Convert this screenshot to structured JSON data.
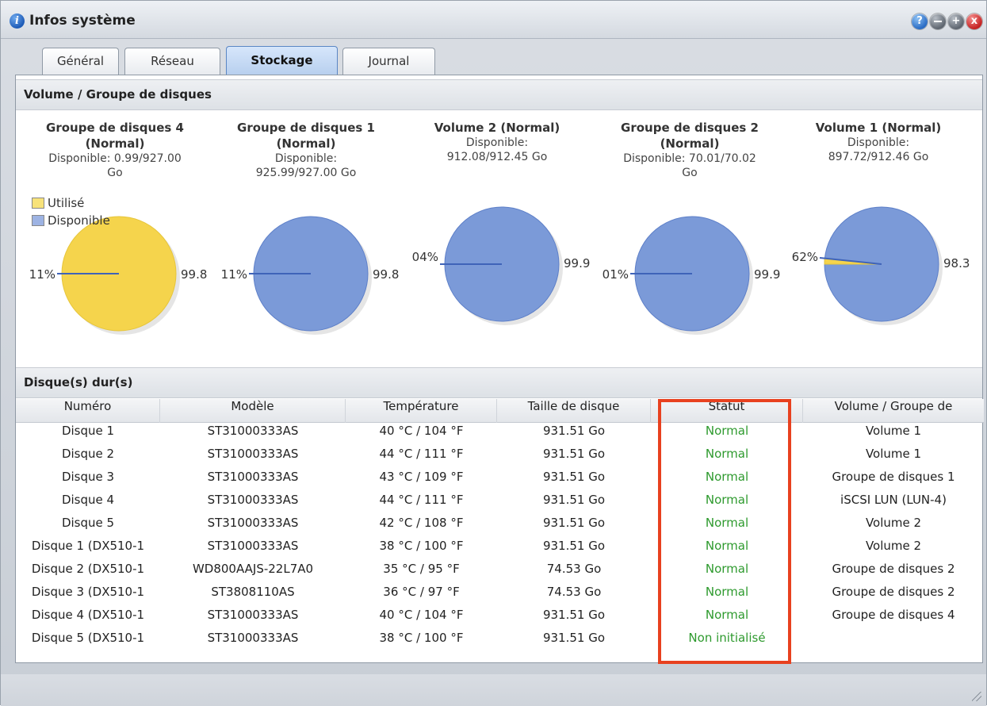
{
  "window": {
    "title": "Infos système",
    "buttons": {
      "help_icon": "?",
      "close_icon": "x"
    }
  },
  "tabs": [
    {
      "label": "Général"
    },
    {
      "label": "Réseau"
    },
    {
      "label": "Stockage",
      "active": true
    },
    {
      "label": "Journal"
    }
  ],
  "volumes_section": {
    "header": "Volume / Groupe de disques",
    "legend": [
      {
        "label": "Utilisé",
        "color": "#f5d44c"
      },
      {
        "label": "Disponible",
        "color": "#7b9ad8"
      }
    ],
    "volumes": [
      {
        "name_line1": "Groupe de disques 4",
        "status": "(Normal)",
        "avail_line1": "Disponible: 0.99/927.00",
        "avail_line2": "Go",
        "used_pct": 99.89,
        "label_left": "11%",
        "label_right": "99.8"
      },
      {
        "name_line1": "Groupe de disques 1",
        "status": "(Normal)",
        "avail_line1": "Disponible:",
        "avail_line2": "925.99/927.00 Go",
        "used_pct": 0.11,
        "label_left": "11%",
        "label_right": "99.8"
      },
      {
        "name_line1": "Volume 2 ",
        "status": "(Normal)",
        "avail_line1": "Disponible:",
        "avail_line2": "912.08/912.45 Go",
        "used_pct": 0.04,
        "label_left": "04%",
        "label_right": "99.9"
      },
      {
        "name_line1": "Groupe de disques 2",
        "status": "(Normal)",
        "avail_line1": "Disponible: 70.01/70.02",
        "avail_line2": "Go",
        "used_pct": 0.01,
        "label_left": "01%",
        "label_right": "99.9"
      },
      {
        "name_line1": "Volume 1 ",
        "status": "(Normal)",
        "avail_line1": "Disponible:",
        "avail_line2": "897.72/912.46 Go",
        "used_pct": 1.62,
        "label_left": "62%",
        "label_right": "98.3"
      }
    ]
  },
  "disks_section": {
    "header": "Disque(s) dur(s)",
    "columns": [
      "Numéro",
      "Modèle",
      "Température",
      "Taille de disque",
      "Statut",
      "Volume / Groupe de"
    ],
    "rows": [
      [
        "Disque 1",
        "ST31000333AS",
        "40 °C / 104 °F",
        "931.51 Go",
        "Normal",
        "Volume 1"
      ],
      [
        "Disque 2",
        "ST31000333AS",
        "44 °C / 111 °F",
        "931.51 Go",
        "Normal",
        "Volume 1"
      ],
      [
        "Disque 3",
        "ST31000333AS",
        "43 °C / 109 °F",
        "931.51 Go",
        "Normal",
        "Groupe de disques 1"
      ],
      [
        "Disque 4",
        "ST31000333AS",
        "44 °C / 111 °F",
        "931.51 Go",
        "Normal",
        "iSCSI LUN (LUN-4)"
      ],
      [
        "Disque 5",
        "ST31000333AS",
        "42 °C / 108 °F",
        "931.51 Go",
        "Normal",
        "Volume 2"
      ],
      [
        "Disque 1 (DX510-1",
        "ST31000333AS",
        "38 °C / 100 °F",
        "931.51 Go",
        "Normal",
        "Volume 2"
      ],
      [
        "Disque 2 (DX510-1",
        "WD800AAJS-22L7A0",
        "35 °C / 95 °F",
        "74.53 Go",
        "Normal",
        "Groupe de disques 2"
      ],
      [
        "Disque 3 (DX510-1",
        "ST3808110AS",
        "36 °C / 97 °F",
        "74.53 Go",
        "Normal",
        "Groupe de disques 2"
      ],
      [
        "Disque 4 (DX510-1",
        "ST31000333AS",
        "40 °C / 104 °F",
        "931.51 Go",
        "Normal",
        "Groupe de disques 4"
      ],
      [
        "Disque 5 (DX510-1",
        "ST31000333AS",
        "38 °C / 100 °F",
        "931.51 Go",
        "Non initialisé",
        ""
      ]
    ]
  }
}
